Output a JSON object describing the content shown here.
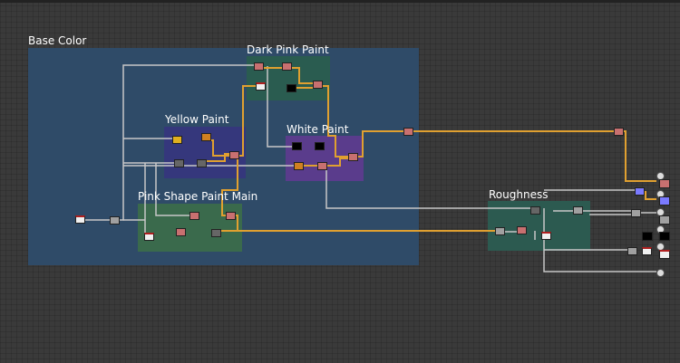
{
  "frames": {
    "base_color": "Base Color",
    "dark_pink_paint": "Dark Pink Paint",
    "yellow_paint": "Yellow Paint",
    "white_paint": "White Paint",
    "pink_shape_paint_main": "Pink Shape Paint Main",
    "roughness": "Roughness"
  },
  "colors": {
    "base_color_frame": "#2f4b68",
    "dark_pink_frame": "#2a5c50",
    "yellow_frame": "#35377c",
    "white_frame": "#5a3c8c",
    "pink_shape_frame": "#3a6a4c",
    "roughness_frame": "#2c5a50",
    "wire_color": "#e0a030",
    "wire_gray": "#c8c8c8"
  }
}
